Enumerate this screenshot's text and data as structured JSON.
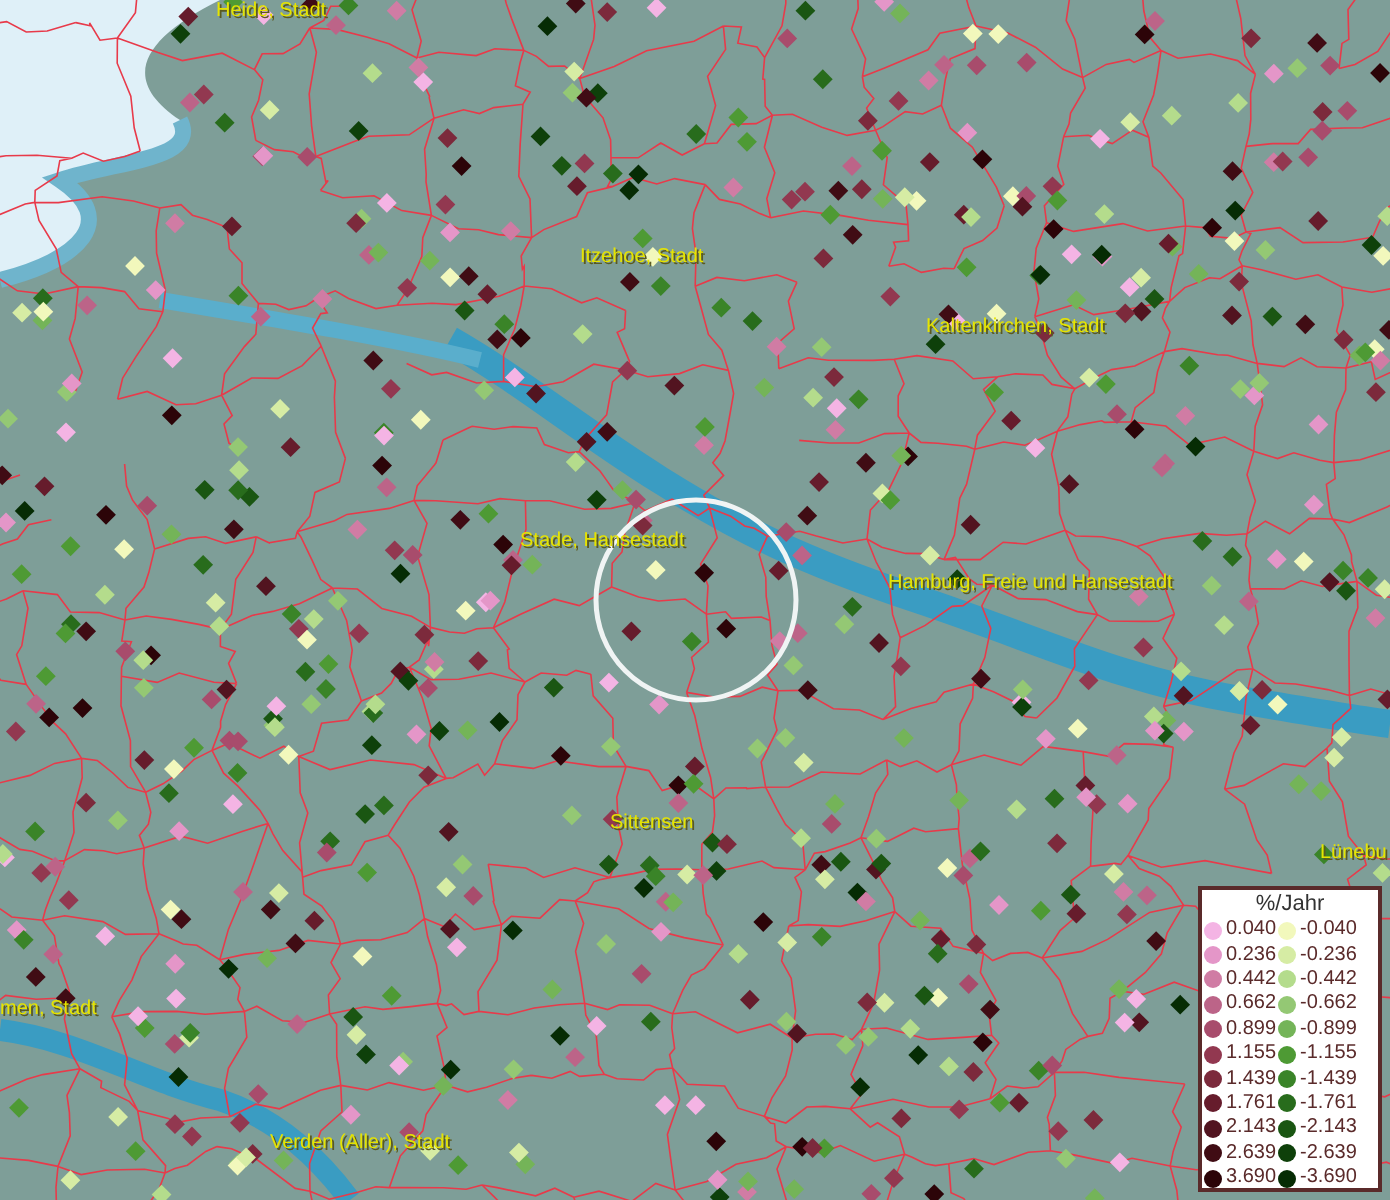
{
  "map": {
    "places": [
      {
        "label": "Heide, Stadt"
      },
      {
        "label": "Itzehoe, Stadt"
      },
      {
        "label": "Kaltenkirchen, Stadt"
      },
      {
        "label": "Stade, Hansestadt"
      },
      {
        "label": "Hamburg, Freie und Hansestadt"
      },
      {
        "label": "Sittensen"
      },
      {
        "label": "Lünebu"
      },
      {
        "label": "men, Stadt"
      },
      {
        "label": "Verden (Aller), Stadt"
      }
    ]
  },
  "legend": {
    "title": "%/Jahr",
    "classes": [
      {
        "label": "0.040",
        "color": "#f4b4e4"
      },
      {
        "label": "0.236",
        "color": "#e496c8"
      },
      {
        "label": "0.442",
        "color": "#d07ca4"
      },
      {
        "label": "0.662",
        "color": "#bc6488"
      },
      {
        "label": "0.899",
        "color": "#a84c6c"
      },
      {
        "label": "1.155",
        "color": "#923850"
      },
      {
        "label": "1.439",
        "color": "#7c2a3c"
      },
      {
        "label": "1.761",
        "color": "#661c2c"
      },
      {
        "label": "2.143",
        "color": "#521420"
      },
      {
        "label": "2.639",
        "color": "#400c14"
      },
      {
        "label": "3.690",
        "color": "#2c0408"
      },
      {
        "label": "-0.040",
        "color": "#f2f8bc"
      },
      {
        "label": "-0.236",
        "color": "#d6eca4"
      },
      {
        "label": "-0.442",
        "color": "#b4dc8c"
      },
      {
        "label": "-0.662",
        "color": "#94c874"
      },
      {
        "label": "-0.899",
        "color": "#74b458"
      },
      {
        "label": "-1.155",
        "color": "#4e9a34"
      },
      {
        "label": "-1.439",
        "color": "#3a8428"
      },
      {
        "label": "-1.761",
        "color": "#286c1c"
      },
      {
        "label": "-2.143",
        "color": "#1a5612"
      },
      {
        "label": "-2.639",
        "color": "#0e400a"
      },
      {
        "label": "-3.690",
        "color": "#062c04"
      }
    ]
  }
}
